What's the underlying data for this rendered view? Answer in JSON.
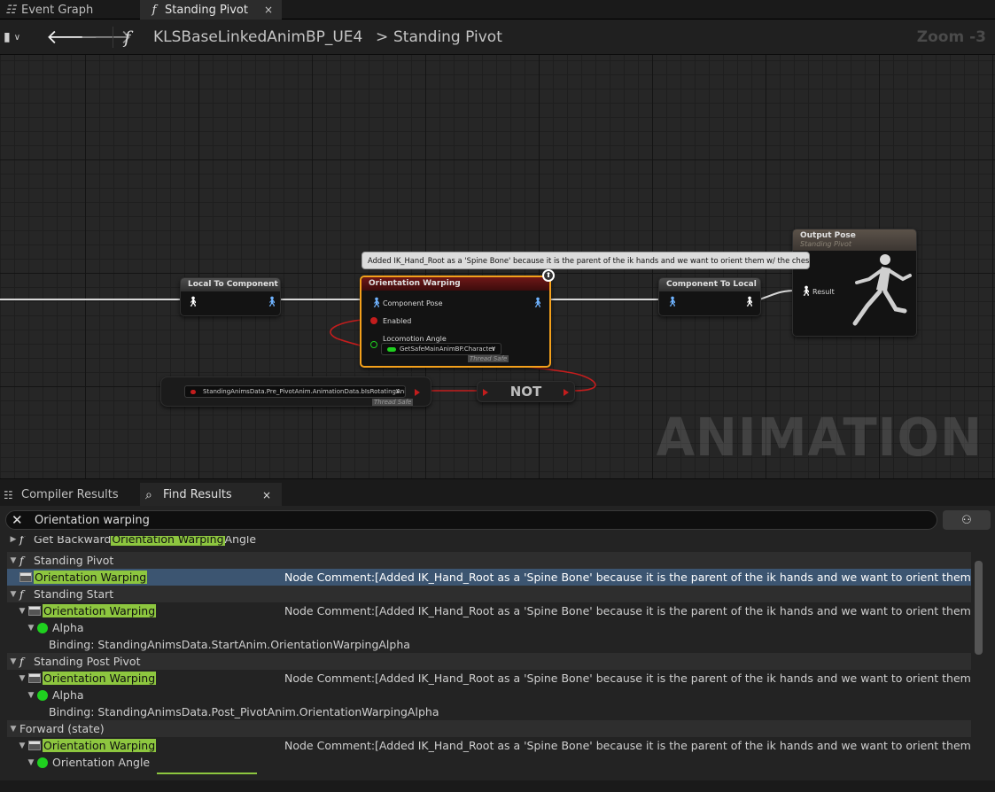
{
  "tabs": [
    {
      "label": "Event Graph",
      "icon": "event-graph-icon"
    },
    {
      "label": "Standing Pivot",
      "icon": "function-icon",
      "close": "×"
    }
  ],
  "breadcrumb": {
    "function_glyph": "f",
    "parts": [
      "KLSBaseLinkedAnimBP_UE4",
      "Standing Pivot"
    ],
    "separator": ">",
    "zoom": "Zoom -3"
  },
  "graph": {
    "comment": "Added IK_Hand_Root as a 'Spine Bone' because it is the parent of the ik hands and we want to orient them w/ the chest.",
    "nodes": {
      "local_to_component": {
        "title": "Local To Component"
      },
      "orientation_warping": {
        "title": "Orientation Warping",
        "pins": [
          "Component Pose",
          "Enabled",
          "Locomotion Angle"
        ],
        "angle_value": "GetSafeMainAnimBP.Character",
        "thread_safe": "Thread Safe"
      },
      "component_to_local": {
        "title": "Component To Local"
      },
      "output_pose": {
        "title": "Output Pose",
        "subtitle": "Standing Pivot",
        "pin": "Result"
      },
      "property_access": {
        "value": "StandingAnimsData.Pre_PivotAnim.AnimationData.bIsRotatingAnim",
        "thread_safe": "Thread Safe"
      },
      "not_node": {
        "title": "NOT"
      }
    },
    "watermark": "ANIMATION",
    "colors": {
      "exec_red": "#c31d1d",
      "selected_orange": "#f3a01b",
      "pose_blue": "#6fb3ff",
      "bool_green": "#1fd01f"
    }
  },
  "panel_tabs": [
    {
      "label": "Compiler Results",
      "icon": "compiler-results-icon"
    },
    {
      "label": "Find Results",
      "icon": "search-icon",
      "close": "×"
    }
  ],
  "find": {
    "query": "Orientation warping",
    "button_icon": "binoculars-icon",
    "results": [
      {
        "type": "fn",
        "parts": [
          "Get Backward ",
          "Orientation Warping",
          " Angle"
        ]
      },
      {
        "type": "fn-cat",
        "label": "Standing Pivot"
      },
      {
        "type": "node",
        "label": "Orientation Warping",
        "comment": "Node Comment:[Added IK_Hand_Root as a 'Spine Bone' because it is the parent of the ik hands and we want to orient them w/ the chest.]"
      },
      {
        "type": "fn-cat",
        "label": "Standing Start"
      },
      {
        "type": "node",
        "label": "Orientation Warping",
        "comment": "Node Comment:[Added IK_Hand_Root as a 'Spine Bone' because it is the parent of the ik hands and we want to orient them w/ the chest.]"
      },
      {
        "type": "pin",
        "label": "Alpha"
      },
      {
        "type": "binding",
        "label": "Binding: StandingAnimsData.StartAnim.OrientationWarpingAlpha"
      },
      {
        "type": "fn-cat",
        "label": "Standing Post Pivot"
      },
      {
        "type": "node",
        "label": "Orientation Warping",
        "comment": "Node Comment:[Added IK_Hand_Root as a 'Spine Bone' because it is the parent of the ik hands and we want to orient them w/ the chest.]"
      },
      {
        "type": "pin",
        "label": "Alpha"
      },
      {
        "type": "binding",
        "label": "Binding: StandingAnimsData.Post_PivotAnim.OrientationWarpingAlpha"
      },
      {
        "type": "cat",
        "label": "Forward (state)"
      },
      {
        "type": "node",
        "label": "Orientation Warping",
        "comment": "Node Comment:[Added IK_Hand_Root as a 'Spine Bone' because it is the parent of the ik hands and we want to orient them w/ the chest.]"
      },
      {
        "type": "pin",
        "label": "Orientation Angle"
      }
    ]
  }
}
